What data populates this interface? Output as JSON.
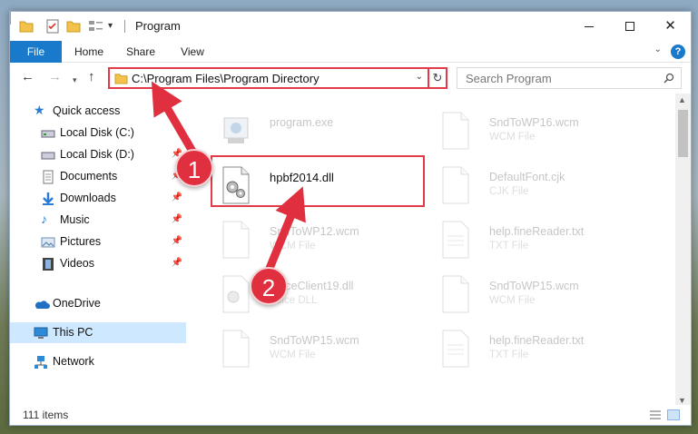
{
  "window": {
    "title": "Program"
  },
  "ribbon": {
    "tabs": [
      "File",
      "Home",
      "Share",
      "View"
    ]
  },
  "nav": {
    "address": "C:\\Program Files\\Program Directory",
    "search_placeholder": "Search Program"
  },
  "sidebar": {
    "items": [
      {
        "label": "Quick access",
        "icon": "star-icon"
      },
      {
        "label": "Local Disk (C:)",
        "icon": "drive-icon"
      },
      {
        "label": "Local Disk (D:)",
        "icon": "drive-icon"
      },
      {
        "label": "Documents",
        "icon": "documents-icon"
      },
      {
        "label": "Downloads",
        "icon": "downloads-icon"
      },
      {
        "label": "Music",
        "icon": "music-icon"
      },
      {
        "label": "Pictures",
        "icon": "pictures-icon"
      },
      {
        "label": "Videos",
        "icon": "videos-icon"
      },
      {
        "label": "OneDrive",
        "icon": "cloud-icon"
      },
      {
        "label": "This PC",
        "icon": "computer-icon"
      },
      {
        "label": "Network",
        "icon": "network-icon"
      }
    ]
  },
  "files": [
    {
      "name": "program.exe",
      "type": ""
    },
    {
      "name": "SndToWP16.wcm",
      "type": "WCM File"
    },
    {
      "name": "hpbf2014.dll",
      "type": ""
    },
    {
      "name": "DefaultFont.cjk",
      "type": "CJK File"
    },
    {
      "name": "SndToWP12.wcm",
      "type": "WCM File"
    },
    {
      "name": "help.fineReader.txt",
      "type": "TXT File"
    },
    {
      "name": "VoiceClient19.dll",
      "type": "Voice DLL"
    },
    {
      "name": "SndToWP15.wcm",
      "type": "WCM File"
    },
    {
      "name": "SndToWP15.wcm",
      "type": "WCM File"
    },
    {
      "name": "help.fineReader.txt",
      "type": "TXT File"
    }
  ],
  "status": {
    "items": "111 items"
  },
  "annotations": {
    "step1": "1",
    "step2": "2"
  },
  "colors": {
    "accent": "#1979ca",
    "highlight": "#e23a48",
    "bubble": "#e0303f"
  }
}
